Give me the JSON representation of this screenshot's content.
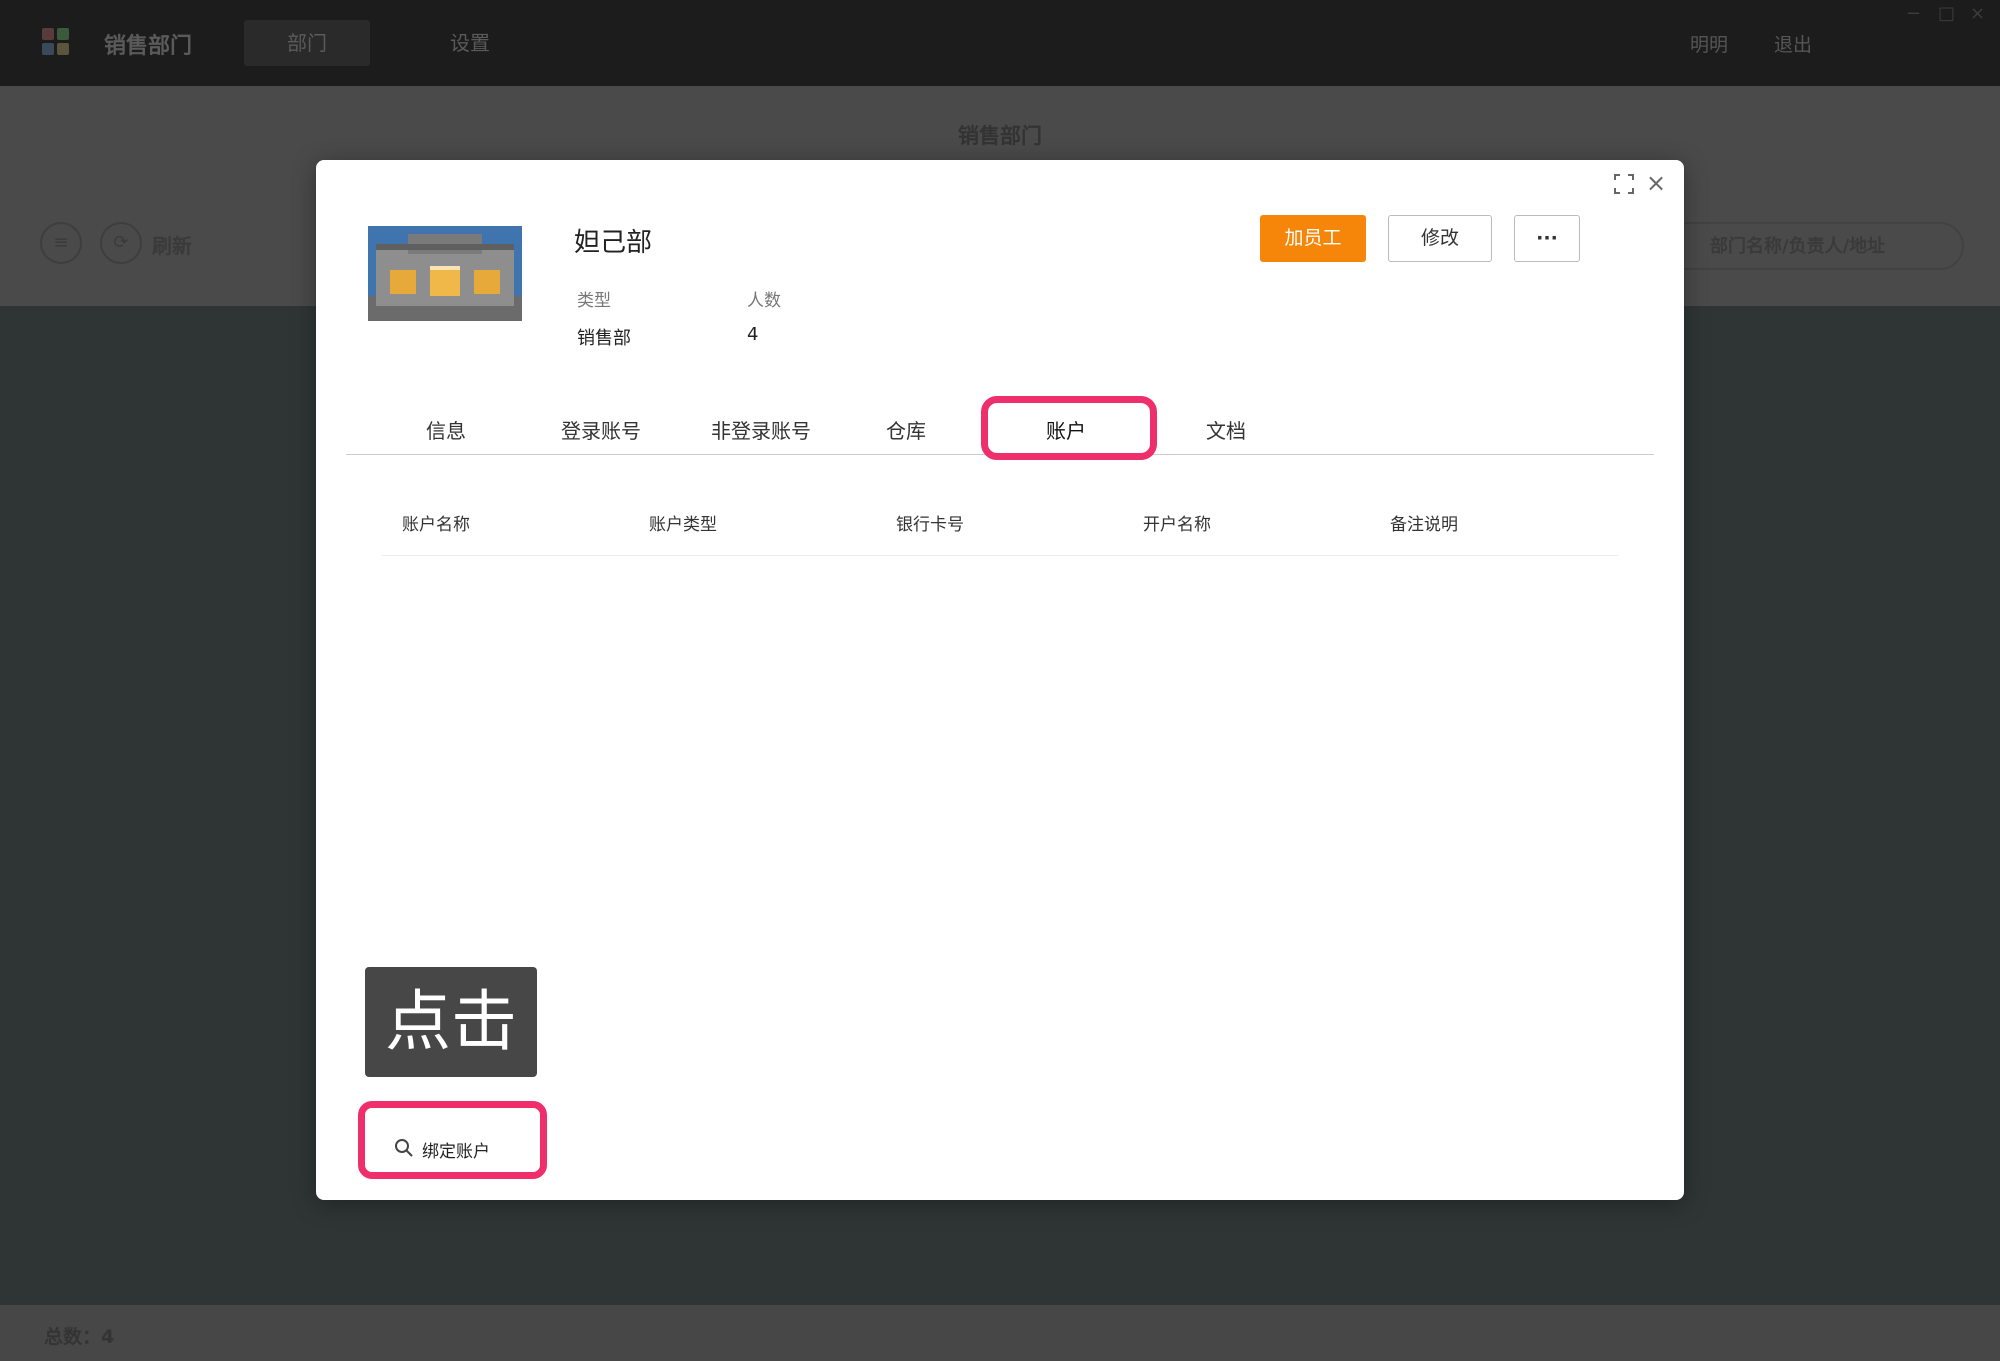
{
  "app": {
    "title": "销售部门",
    "nav_tabs": [
      "部门",
      "设置"
    ],
    "top_links": [
      "明明",
      "退出"
    ],
    "window_controls": [
      "−",
      "□",
      "×"
    ]
  },
  "subheader": {
    "title": "销售部门",
    "refresh_label": "刷新",
    "search_placeholder": "部门名称/负责人/地址"
  },
  "footer": {
    "total_text": "总数：4"
  },
  "modal": {
    "department_name": "妲己部",
    "meta": [
      {
        "label": "类型",
        "value": "销售部"
      },
      {
        "label": "人数",
        "value": "4"
      }
    ],
    "buttons": {
      "add_employee": "加员工",
      "edit": "修改",
      "more": "···"
    },
    "tabs": [
      "信息",
      "登录账号",
      "非登录账号",
      "仓库",
      "账户",
      "文档"
    ],
    "active_tab": "账户",
    "table": {
      "columns": [
        "账户名称",
        "账户类型",
        "银行卡号",
        "开户名称",
        "备注说明"
      ],
      "rows": []
    },
    "click_hint": "点击",
    "bind_account_label": "绑定账户"
  },
  "colors": {
    "accent_orange": "#f5860a",
    "highlight_pink": "#ef2f6c",
    "overlay_dark": "#2f3535"
  },
  "icons": [
    "app-logo-icon",
    "list-icon",
    "refresh-icon",
    "search-icon",
    "expand-icon",
    "close-icon"
  ]
}
